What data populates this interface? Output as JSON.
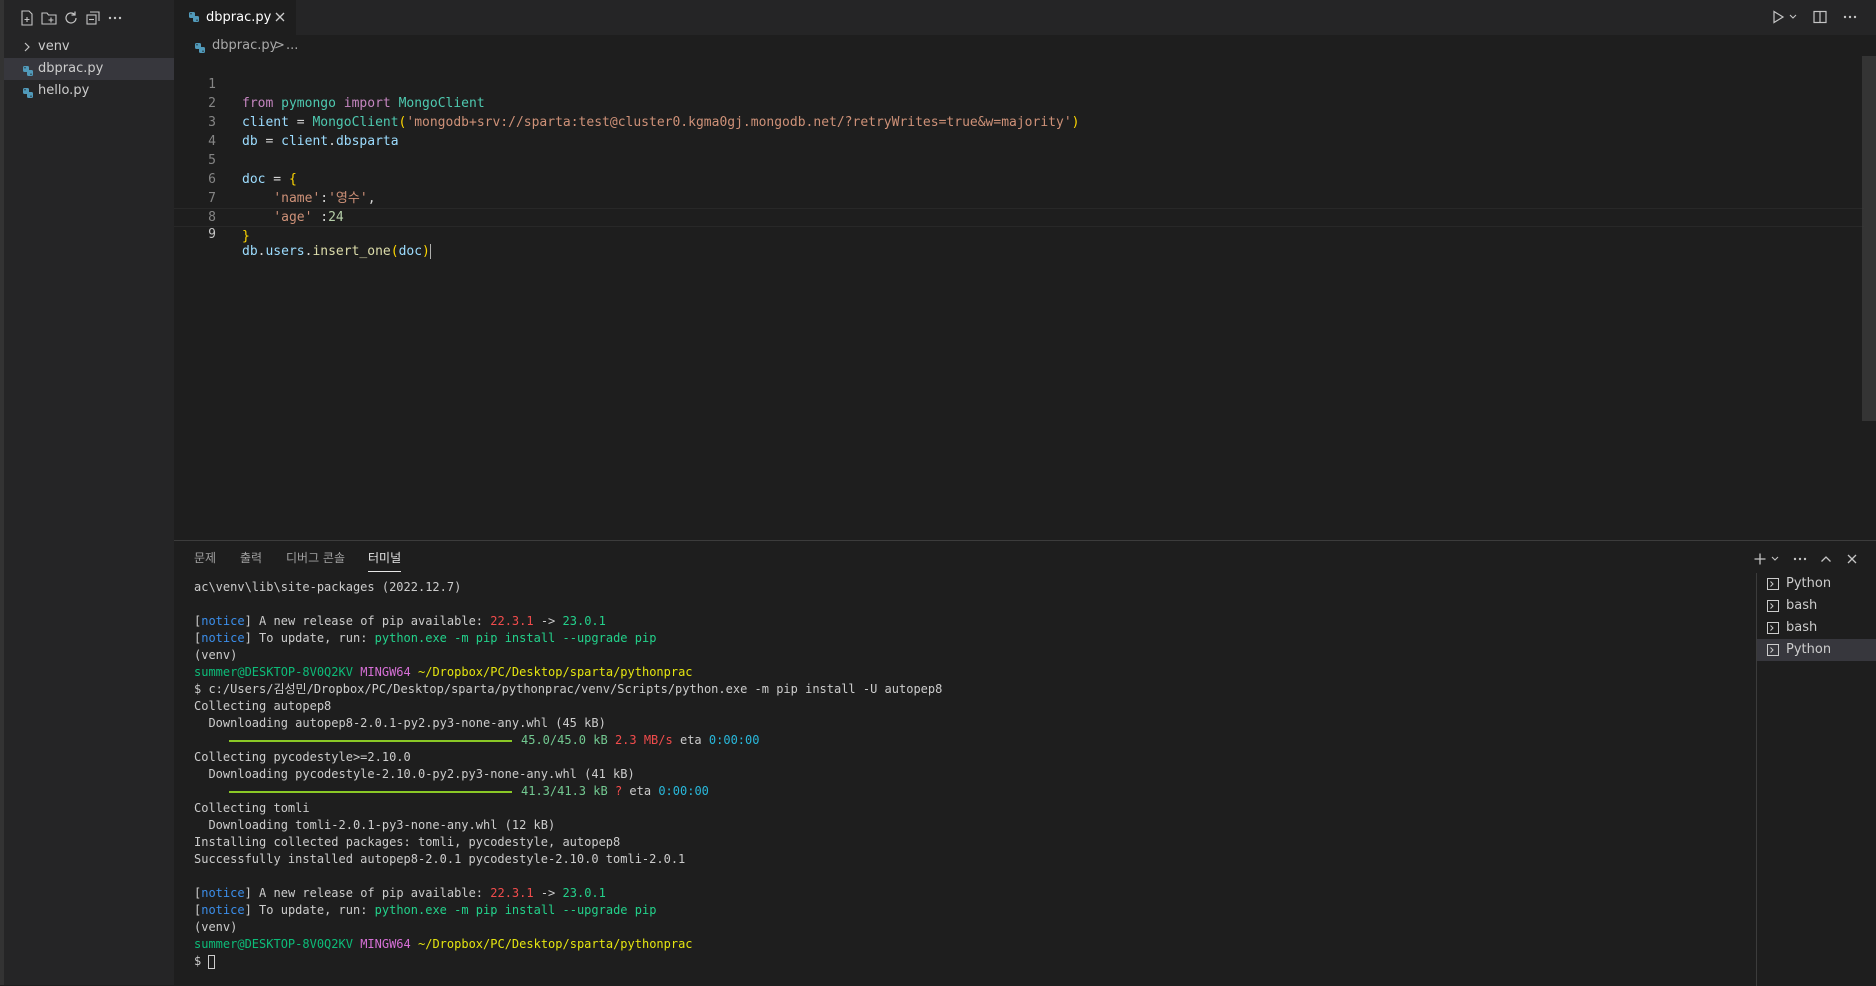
{
  "explorer": {
    "items": [
      {
        "label": "venv",
        "kind": "folder"
      },
      {
        "label": "dbprac.py",
        "kind": "python",
        "selected": true
      },
      {
        "label": "hello.py",
        "kind": "python"
      }
    ]
  },
  "editor": {
    "tab_label": "dbprac.py",
    "breadcrumb": {
      "file": "dbprac.py",
      "separator": ">",
      "more": "..."
    },
    "line_numbers": [
      "1",
      "2",
      "3",
      "4",
      "5",
      "6",
      "7",
      "8",
      "9"
    ],
    "code": {
      "l1": {
        "t1": "from",
        "t2": "pymongo",
        "t3": "import",
        "t4": "MongoClient"
      },
      "l2": {
        "t1": "client",
        "t2": " = ",
        "t3": "MongoClient",
        "t4": "(",
        "t5": "'mongodb+srv://sparta:test@cluster0.kgma0gj.mongodb.net/?retryWrites=true&w=majority'",
        "t6": ")"
      },
      "l3": {
        "t1": "db",
        "t2": " = ",
        "t3": "client",
        "t4": ".",
        "t5": "dbsparta"
      },
      "l5": {
        "t1": "doc",
        "t2": " = ",
        "t3": "{"
      },
      "l6": {
        "t1": "'name'",
        "t2": ":",
        "t3": "'영수'",
        "t4": ","
      },
      "l7": {
        "t1": "'age'",
        "t2": " :",
        "t3": "24"
      },
      "l8": {
        "t1": "}"
      },
      "l9": {
        "t1": "db",
        "t2": ".",
        "t3": "users",
        "t4": ".",
        "t5": "insert_one",
        "t6": "(",
        "t7": "doc",
        "t8": ")"
      }
    }
  },
  "panel": {
    "tabs": [
      "문제",
      "출력",
      "디버그 콘솔",
      "터미널"
    ],
    "active_tab": "터미널",
    "terminal": {
      "l1": "ac\\venv\\lib\\site-packages (2022.12.7)",
      "notice": "notice",
      "release_text": " A new release of pip available: ",
      "old_ver": "22.3.1",
      "arrow": " -> ",
      "new_ver": "23.0.1",
      "update_text": " To update, run: ",
      "update_cmd": "python.exe -m pip install --upgrade pip",
      "venv": "(venv)",
      "user": "summer@DESKTOP-8V0Q2KV",
      "mingw": "MINGW64",
      "path": "~/Dropbox/PC/Desktop/sparta/pythonprac",
      "cmd": "$ c:/Users/김성민/Dropbox/PC/Desktop/sparta/pythonprac/venv/Scripts/python.exe -m pip install -U autopep8",
      "collect1": "Collecting autopep8",
      "dl1": "  Downloading autopep8-2.0.1-py2.py3-none-any.whl (45 kB)",
      "prog1_size": "45.0/45.0 kB",
      "prog1_speed": "2.3 MB/s",
      "eta_label": "eta",
      "eta_val": "0:00:00",
      "collect2": "Collecting pycodestyle>=2.10.0",
      "dl2": "  Downloading pycodestyle-2.10.0-py2.py3-none-any.whl (41 kB)",
      "prog2_size": "41.3/41.3 kB",
      "prog2_speed": "?",
      "collect3": "Collecting tomli",
      "dl3": "  Downloading tomli-2.0.1-py3-none-any.whl (12 kB)",
      "installing": "Installing collected packages: tomli, pycodestyle, autopep8",
      "success": "Successfully installed autopep8-2.0.1 pycodestyle-2.10.0 tomli-2.0.1",
      "prompt": "$ "
    },
    "terminal_list": [
      {
        "label": "Python",
        "selected": false
      },
      {
        "label": "bash",
        "selected": false
      },
      {
        "label": "bash",
        "selected": false
      },
      {
        "label": "Python",
        "selected": true
      }
    ]
  },
  "colors": {
    "accent": "#007acc",
    "python_icon": "#519aba",
    "download_bar": "#8ac926"
  }
}
